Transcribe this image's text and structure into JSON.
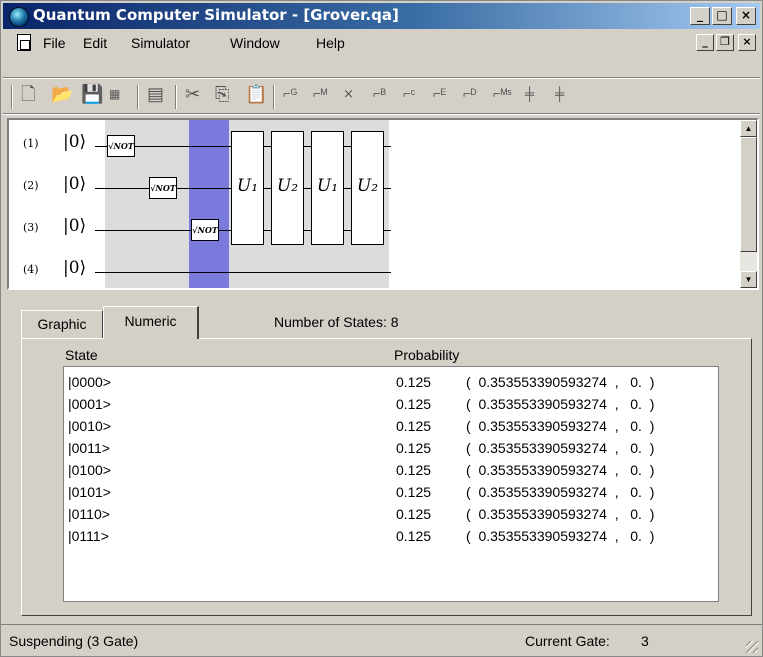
{
  "window": {
    "title": "Quantum Computer Simulator - [Grover.qa]",
    "caption_buttons": {
      "minimize": "_",
      "maximize": "□",
      "close": "×"
    },
    "mdi_buttons": {
      "minimize": "_",
      "restore": "❐",
      "close": "×"
    }
  },
  "menu": {
    "items": [
      {
        "label": "File"
      },
      {
        "label": "Edit"
      },
      {
        "label": "Simulator"
      },
      {
        "label": "Window"
      },
      {
        "label": "Help"
      }
    ]
  },
  "toolbar": {
    "icons": [
      "new-icon",
      "open-icon",
      "save-icon",
      "gate-config-icon",
      "list-icon",
      "cut-icon",
      "copy-icon",
      "paste-icon",
      "gate-g-icon",
      "gate-m-icon",
      "gate-x-icon",
      "gate-b-icon",
      "gate-c-icon",
      "gate-e-icon",
      "gate-d-icon",
      "gate-ms-icon",
      "gate-add-icon",
      "gate-add2-icon"
    ]
  },
  "circuit": {
    "wires": [
      {
        "label": "(1)",
        "ket": "|0⟩"
      },
      {
        "label": "(2)",
        "ket": "|0⟩"
      },
      {
        "label": "(3)",
        "ket": "|0⟩"
      },
      {
        "label": "(4)",
        "ket": "|0⟩"
      }
    ],
    "small_gates": [
      {
        "label": "√NOT",
        "wire": 1
      },
      {
        "label": "√NOT",
        "wire": 2
      },
      {
        "label": "√NOT",
        "wire": 3
      }
    ],
    "big_gates": [
      {
        "label": "U₁"
      },
      {
        "label": "U₂"
      },
      {
        "label": "U₁"
      },
      {
        "label": "U₂"
      }
    ],
    "highlighted_column": 3
  },
  "tabs": [
    {
      "label": "Graphic",
      "active": false
    },
    {
      "label": "Numeric",
      "active": true
    }
  ],
  "states_info": {
    "label": "Number of States:",
    "value": "8"
  },
  "table": {
    "headers": {
      "state": "State",
      "probability": "Probability"
    },
    "rows": [
      {
        "state": "|0000>",
        "prob": "0.125",
        "amp": "(  0.353553390593274  ,   0.  )"
      },
      {
        "state": "|0001>",
        "prob": "0.125",
        "amp": "(  0.353553390593274  ,   0.  )"
      },
      {
        "state": "|0010>",
        "prob": "0.125",
        "amp": "(  0.353553390593274  ,   0.  )"
      },
      {
        "state": "|0011>",
        "prob": "0.125",
        "amp": "(  0.353553390593274  ,   0.  )"
      },
      {
        "state": "|0100>",
        "prob": "0.125",
        "amp": "(  0.353553390593274  ,   0.  )"
      },
      {
        "state": "|0101>",
        "prob": "0.125",
        "amp": "(  0.353553390593274  ,   0.  )"
      },
      {
        "state": "|0110>",
        "prob": "0.125",
        "amp": "(  0.353553390593274  ,   0.  )"
      },
      {
        "state": "|0111>",
        "prob": "0.125",
        "amp": "(  0.353553390593274  ,   0.  )"
      }
    ]
  },
  "status": {
    "left": "Suspending (3 Gate)",
    "current_gate_label": "Current Gate:",
    "current_gate_value": "3"
  },
  "colors": {
    "title_start": "#0a246a",
    "title_end": "#a6caf0",
    "highlight_column": "#7a7adc",
    "column_shade": "#dcdcdc"
  }
}
